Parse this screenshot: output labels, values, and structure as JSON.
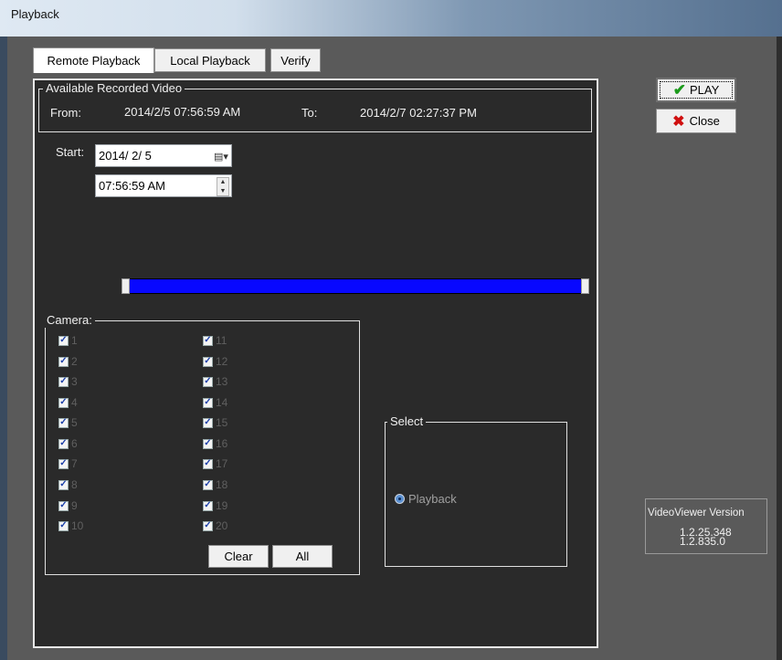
{
  "window": {
    "title": "Playback"
  },
  "tabs": [
    "Remote Playback",
    "Local Playback",
    "Verify"
  ],
  "available": {
    "legend": "Available Recorded Video",
    "from_label": "From:",
    "from_value": "2014/2/5  07:56:59 AM",
    "to_label": "To:",
    "to_value": "2014/2/7  02:27:37 PM"
  },
  "start": {
    "label": "Start:",
    "date": "2014/  2/  5",
    "time": "07:56:59  AM"
  },
  "timeline": {
    "start_fraction": 0.0,
    "end_fraction": 1.0,
    "color": "#0808ff"
  },
  "camera": {
    "legend": "Camera:",
    "left": [
      "1",
      "2",
      "3",
      "4",
      "5",
      "6",
      "7",
      "8",
      "9",
      "10"
    ],
    "right": [
      "11",
      "12",
      "13",
      "14",
      "15",
      "16",
      "17",
      "18",
      "19",
      "20"
    ],
    "clear_label": "Clear",
    "all_label": "All"
  },
  "select": {
    "legend": "Select",
    "option": "Playback"
  },
  "buttons": {
    "play": "PLAY",
    "close": "Close"
  },
  "version": {
    "label": "VideoViewer Version",
    "v1": "1.2.25.348",
    "v2": "1.2.835.0"
  }
}
